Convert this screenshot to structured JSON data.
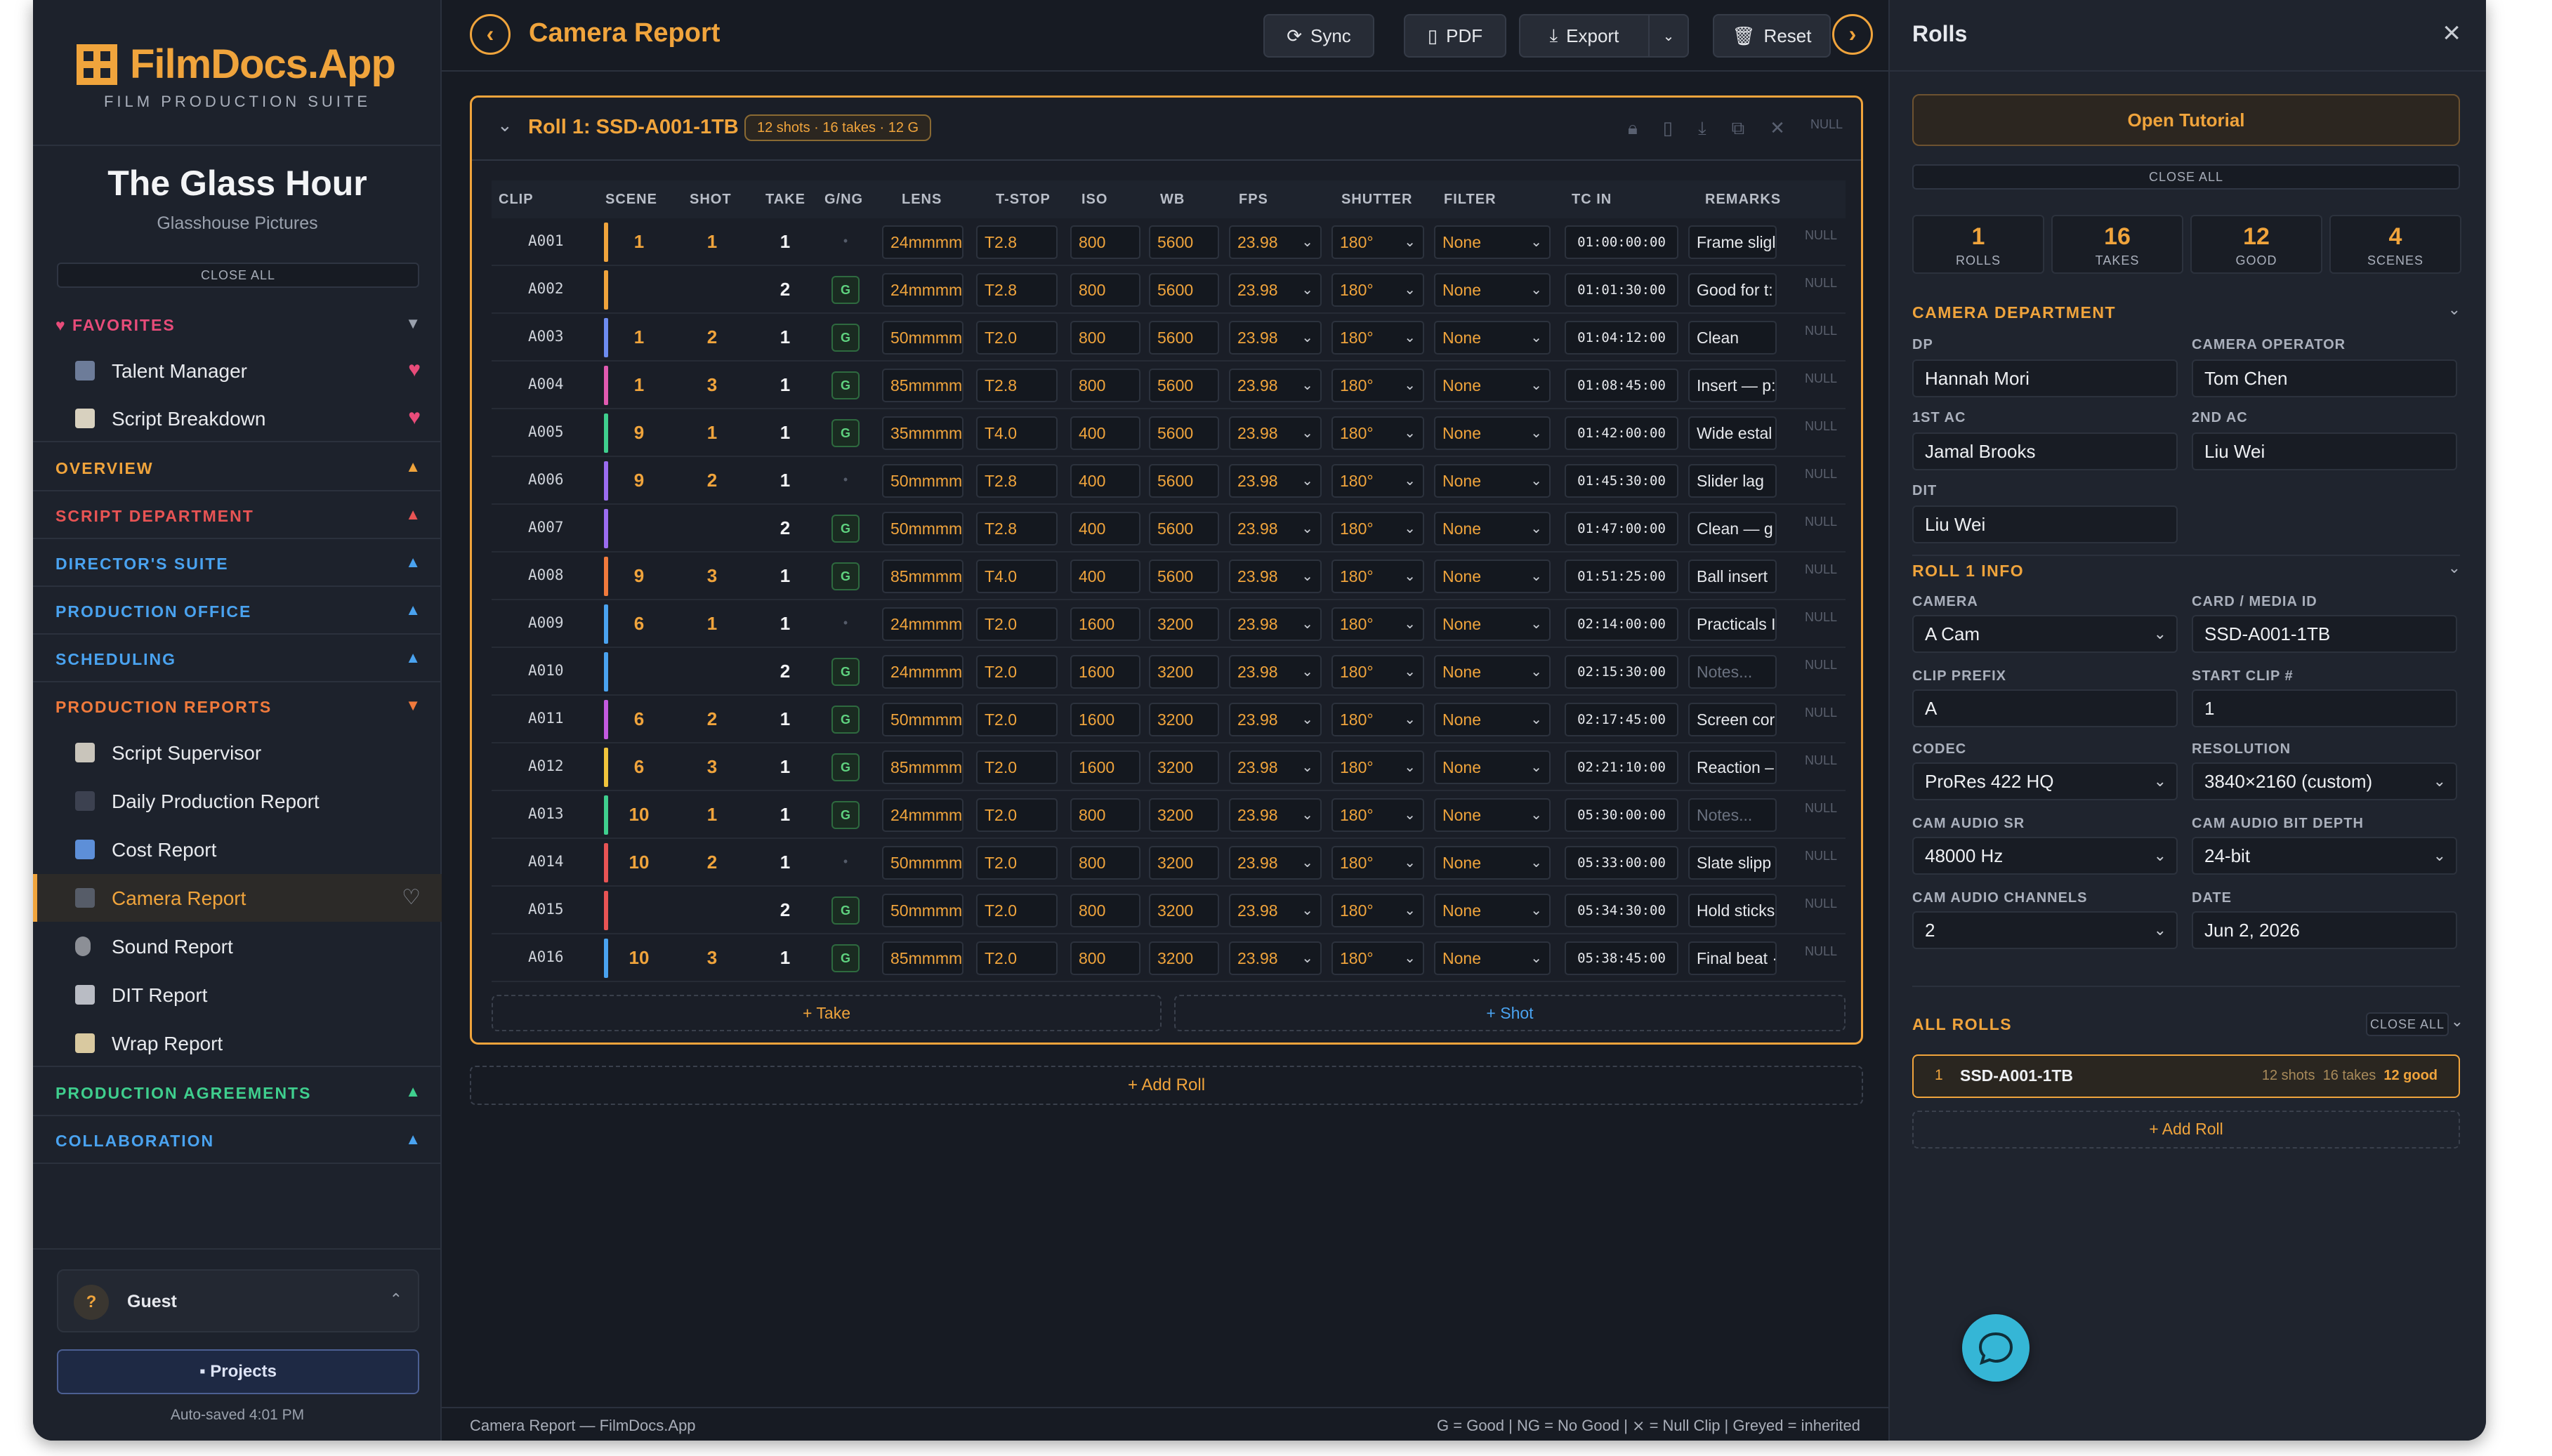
{
  "app": {
    "logo_name": "FilmDocs.App",
    "logo_sub": "FILM PRODUCTION SUITE",
    "project_title": "The Glass Hour",
    "project_company": "Glasshouse Pictures",
    "close_all": "CLOSE ALL",
    "accent_color": "#f0a43c"
  },
  "sidebar": {
    "favorites_label": "FAVORITES",
    "favorites": [
      {
        "label": "Talent Manager",
        "icon": "person-icon"
      },
      {
        "label": "Script Breakdown",
        "icon": "notepad-icon"
      }
    ],
    "sections": [
      {
        "label": "OVERVIEW",
        "color": "#f0a43c"
      },
      {
        "label": "SCRIPT DEPARTMENT",
        "color": "#e85454"
      },
      {
        "label": "DIRECTOR'S SUITE",
        "color": "#4aa3f0"
      },
      {
        "label": "PRODUCTION OFFICE",
        "color": "#4aa3f0"
      },
      {
        "label": "SCHEDULING",
        "color": "#4aa3f0"
      },
      {
        "label": "PRODUCTION REPORTS",
        "color": "#f07a3c"
      }
    ],
    "report_items": [
      {
        "label": "Script Supervisor",
        "icon": "clipboard-icon"
      },
      {
        "label": "Daily Production Report",
        "icon": "clapper-icon"
      },
      {
        "label": "Cost Report",
        "icon": "bar-chart-icon"
      },
      {
        "label": "Camera Report",
        "icon": "camera-icon"
      },
      {
        "label": "Sound Report",
        "icon": "microphone-icon"
      },
      {
        "label": "DIT Report",
        "icon": "disk-icon"
      },
      {
        "label": "Wrap Report",
        "icon": "film-icon"
      }
    ],
    "bottom_sections": [
      {
        "label": "PRODUCTION AGREEMENTS",
        "color": "#3fcf8e"
      },
      {
        "label": "COLLABORATION",
        "color": "#4aa3f0"
      }
    ],
    "user_initial": "?",
    "user_name": "Guest",
    "projects_label": "Projects",
    "autosave": "Auto-saved 4:01 PM"
  },
  "topbar": {
    "title": "Camera Report",
    "sync": "Sync",
    "pdf": "PDF",
    "export": "Export",
    "reset": "Reset"
  },
  "roll": {
    "title": "Roll 1: SSD-A001-1TB",
    "badge": "12 shots · 16 takes · 12 G",
    "null_label": "NULL",
    "columns": [
      "CLIP",
      "SCENE",
      "SHOT",
      "TAKE",
      "G/NG",
      "LENS",
      "T-STOP",
      "ISO",
      "WB",
      "FPS",
      "SHUTTER",
      "FILTER",
      "TC IN",
      "REMARKS"
    ],
    "rows": [
      {
        "clip": "A001",
        "bar": "#f0a43c",
        "scene": "1",
        "shot": "1",
        "take": "1",
        "g": "•",
        "lens": "24mmmm",
        "tstop": "T2.8",
        "iso": "800",
        "wb": "5600",
        "fps": "23.98",
        "shutter": "180°",
        "filter": "None",
        "tc": "01:00:00:00",
        "remarks": "Frame sligl"
      },
      {
        "clip": "A002",
        "bar": "#f0a43c",
        "scene": "",
        "shot": "",
        "take": "2",
        "g": "G",
        "lens": "24mmmm",
        "tstop": "T2.8",
        "iso": "800",
        "wb": "5600",
        "fps": "23.98",
        "shutter": "180°",
        "filter": "None",
        "tc": "01:01:30:00",
        "remarks": "Good for t:"
      },
      {
        "clip": "A003",
        "bar": "#6d8cf0",
        "scene": "1",
        "shot": "2",
        "take": "1",
        "g": "G",
        "lens": "50mmmm",
        "tstop": "T2.0",
        "iso": "800",
        "wb": "5600",
        "fps": "23.98",
        "shutter": "180°",
        "filter": "None",
        "tc": "01:04:12:00",
        "remarks": "Clean"
      },
      {
        "clip": "A004",
        "bar": "#e05ab0",
        "scene": "1",
        "shot": "3",
        "take": "1",
        "g": "G",
        "lens": "85mmmm",
        "tstop": "T2.8",
        "iso": "800",
        "wb": "5600",
        "fps": "23.98",
        "shutter": "180°",
        "filter": "None",
        "tc": "01:08:45:00",
        "remarks": "Insert — p:"
      },
      {
        "clip": "A005",
        "bar": "#3fcf8e",
        "scene": "9",
        "shot": "1",
        "take": "1",
        "g": "G",
        "lens": "35mmmm",
        "tstop": "T4.0",
        "iso": "400",
        "wb": "5600",
        "fps": "23.98",
        "shutter": "180°",
        "filter": "None",
        "tc": "01:42:00:00",
        "remarks": "Wide estal"
      },
      {
        "clip": "A006",
        "bar": "#9b6cf0",
        "scene": "9",
        "shot": "2",
        "take": "1",
        "g": "•",
        "lens": "50mmmm",
        "tstop": "T2.8",
        "iso": "400",
        "wb": "5600",
        "fps": "23.98",
        "shutter": "180°",
        "filter": "None",
        "tc": "01:45:30:00",
        "remarks": "Slider lag"
      },
      {
        "clip": "A007",
        "bar": "#9b6cf0",
        "scene": "",
        "shot": "",
        "take": "2",
        "g": "G",
        "lens": "50mmmm",
        "tstop": "T2.8",
        "iso": "400",
        "wb": "5600",
        "fps": "23.98",
        "shutter": "180°",
        "filter": "None",
        "tc": "01:47:00:00",
        "remarks": "Clean — g"
      },
      {
        "clip": "A008",
        "bar": "#f07a3c",
        "scene": "9",
        "shot": "3",
        "take": "1",
        "g": "G",
        "lens": "85mmmm",
        "tstop": "T4.0",
        "iso": "400",
        "wb": "5600",
        "fps": "23.98",
        "shutter": "180°",
        "filter": "None",
        "tc": "01:51:25:00",
        "remarks": "Ball insert"
      },
      {
        "clip": "A009",
        "bar": "#4aa3f0",
        "scene": "6",
        "shot": "1",
        "take": "1",
        "g": "•",
        "lens": "24mmmm",
        "tstop": "T2.0",
        "iso": "1600",
        "wb": "3200",
        "fps": "23.98",
        "shutter": "180°",
        "filter": "None",
        "tc": "02:14:00:00",
        "remarks": "Practicals I"
      },
      {
        "clip": "A010",
        "bar": "#4aa3f0",
        "scene": "",
        "shot": "",
        "take": "2",
        "g": "G",
        "lens": "24mmmm",
        "tstop": "T2.0",
        "iso": "1600",
        "wb": "3200",
        "fps": "23.98",
        "shutter": "180°",
        "filter": "None",
        "tc": "02:15:30:00",
        "remarks": "",
        "remarks_placeholder": "Notes..."
      },
      {
        "clip": "A011",
        "bar": "#c35ae0",
        "scene": "6",
        "shot": "2",
        "take": "1",
        "g": "G",
        "lens": "50mmmm",
        "tstop": "T2.0",
        "iso": "1600",
        "wb": "3200",
        "fps": "23.98",
        "shutter": "180°",
        "filter": "None",
        "tc": "02:17:45:00",
        "remarks": "Screen cor"
      },
      {
        "clip": "A012",
        "bar": "#f0c43c",
        "scene": "6",
        "shot": "3",
        "take": "1",
        "g": "G",
        "lens": "85mmmm",
        "tstop": "T2.0",
        "iso": "1600",
        "wb": "3200",
        "fps": "23.98",
        "shutter": "180°",
        "filter": "None",
        "tc": "02:21:10:00",
        "remarks": "Reaction –"
      },
      {
        "clip": "A013",
        "bar": "#3fcf8e",
        "scene": "10",
        "shot": "1",
        "take": "1",
        "g": "G",
        "lens": "24mmmm",
        "tstop": "T2.0",
        "iso": "800",
        "wb": "3200",
        "fps": "23.98",
        "shutter": "180°",
        "filter": "None",
        "tc": "05:30:00:00",
        "remarks": "",
        "remarks_placeholder": "Notes..."
      },
      {
        "clip": "A014",
        "bar": "#e85454",
        "scene": "10",
        "shot": "2",
        "take": "1",
        "g": "•",
        "lens": "50mmmm",
        "tstop": "T2.0",
        "iso": "800",
        "wb": "3200",
        "fps": "23.98",
        "shutter": "180°",
        "filter": "None",
        "tc": "05:33:00:00",
        "remarks": "Slate slipp"
      },
      {
        "clip": "A015",
        "bar": "#e85454",
        "scene": "",
        "shot": "",
        "take": "2",
        "g": "G",
        "lens": "50mmmm",
        "tstop": "T2.0",
        "iso": "800",
        "wb": "3200",
        "fps": "23.98",
        "shutter": "180°",
        "filter": "None",
        "tc": "05:34:30:00",
        "remarks": "Hold sticks"
      },
      {
        "clip": "A016",
        "bar": "#4aa3f0",
        "scene": "10",
        "shot": "3",
        "take": "1",
        "g": "G",
        "lens": "85mmmm",
        "tstop": "T2.0",
        "iso": "800",
        "wb": "3200",
        "fps": "23.98",
        "shutter": "180°",
        "filter": "None",
        "tc": "05:38:45:00",
        "remarks": "Final beat ·"
      }
    ],
    "add_take": "+ Take",
    "add_shot": "+ Shot",
    "add_roll": "+ Add Roll"
  },
  "footer": {
    "left": "Camera Report — FilmDocs.App",
    "right": "G = Good  |  NG = No Good  |  ⨯ = Null Clip  |  Greyed = inherited"
  },
  "panel": {
    "title": "Rolls",
    "tutorial": "Open Tutorial",
    "close_all": "CLOSE ALL",
    "stats": [
      {
        "value": "1",
        "label": "ROLLS"
      },
      {
        "value": "16",
        "label": "TAKES"
      },
      {
        "value": "12",
        "label": "GOOD"
      },
      {
        "value": "4",
        "label": "SCENES"
      }
    ],
    "camera_dept_label": "CAMERA DEPARTMENT",
    "dp_label": "DP",
    "dp": "Hannah Mori",
    "operator_label": "CAMERA OPERATOR",
    "operator": "Tom Chen",
    "ac1_label": "1ST AC",
    "ac1": "Jamal Brooks",
    "ac2_label": "2ND AC",
    "ac2": "Liu Wei",
    "dit_label": "DIT",
    "dit": "Liu Wei",
    "roll_info_label": "ROLL 1 INFO",
    "camera_label": "CAMERA",
    "camera": "A Cam",
    "card_label": "CARD / MEDIA ID",
    "card": "SSD-A001-1TB",
    "prefix_label": "CLIP PREFIX",
    "prefix": "A",
    "start_label": "START CLIP #",
    "start": "1",
    "codec_label": "CODEC",
    "codec": "ProRes 422 HQ",
    "res_label": "RESOLUTION",
    "res": "3840×2160 (custom)",
    "sr_label": "CAM AUDIO SR",
    "sr": "48000 Hz",
    "bitdepth_label": "CAM AUDIO BIT DEPTH",
    "bitdepth": "24-bit",
    "channels_label": "CAM AUDIO CHANNELS",
    "channels": "2",
    "date_label": "DATE",
    "date": "Jun 2, 2026",
    "all_rolls_label": "ALL ROLLS",
    "roll_card": {
      "num": "1",
      "id": "SSD-A001-1TB",
      "shots": "12 shots",
      "takes": "16 takes",
      "good": "12 good"
    },
    "add_roll": "+ Add Roll"
  }
}
